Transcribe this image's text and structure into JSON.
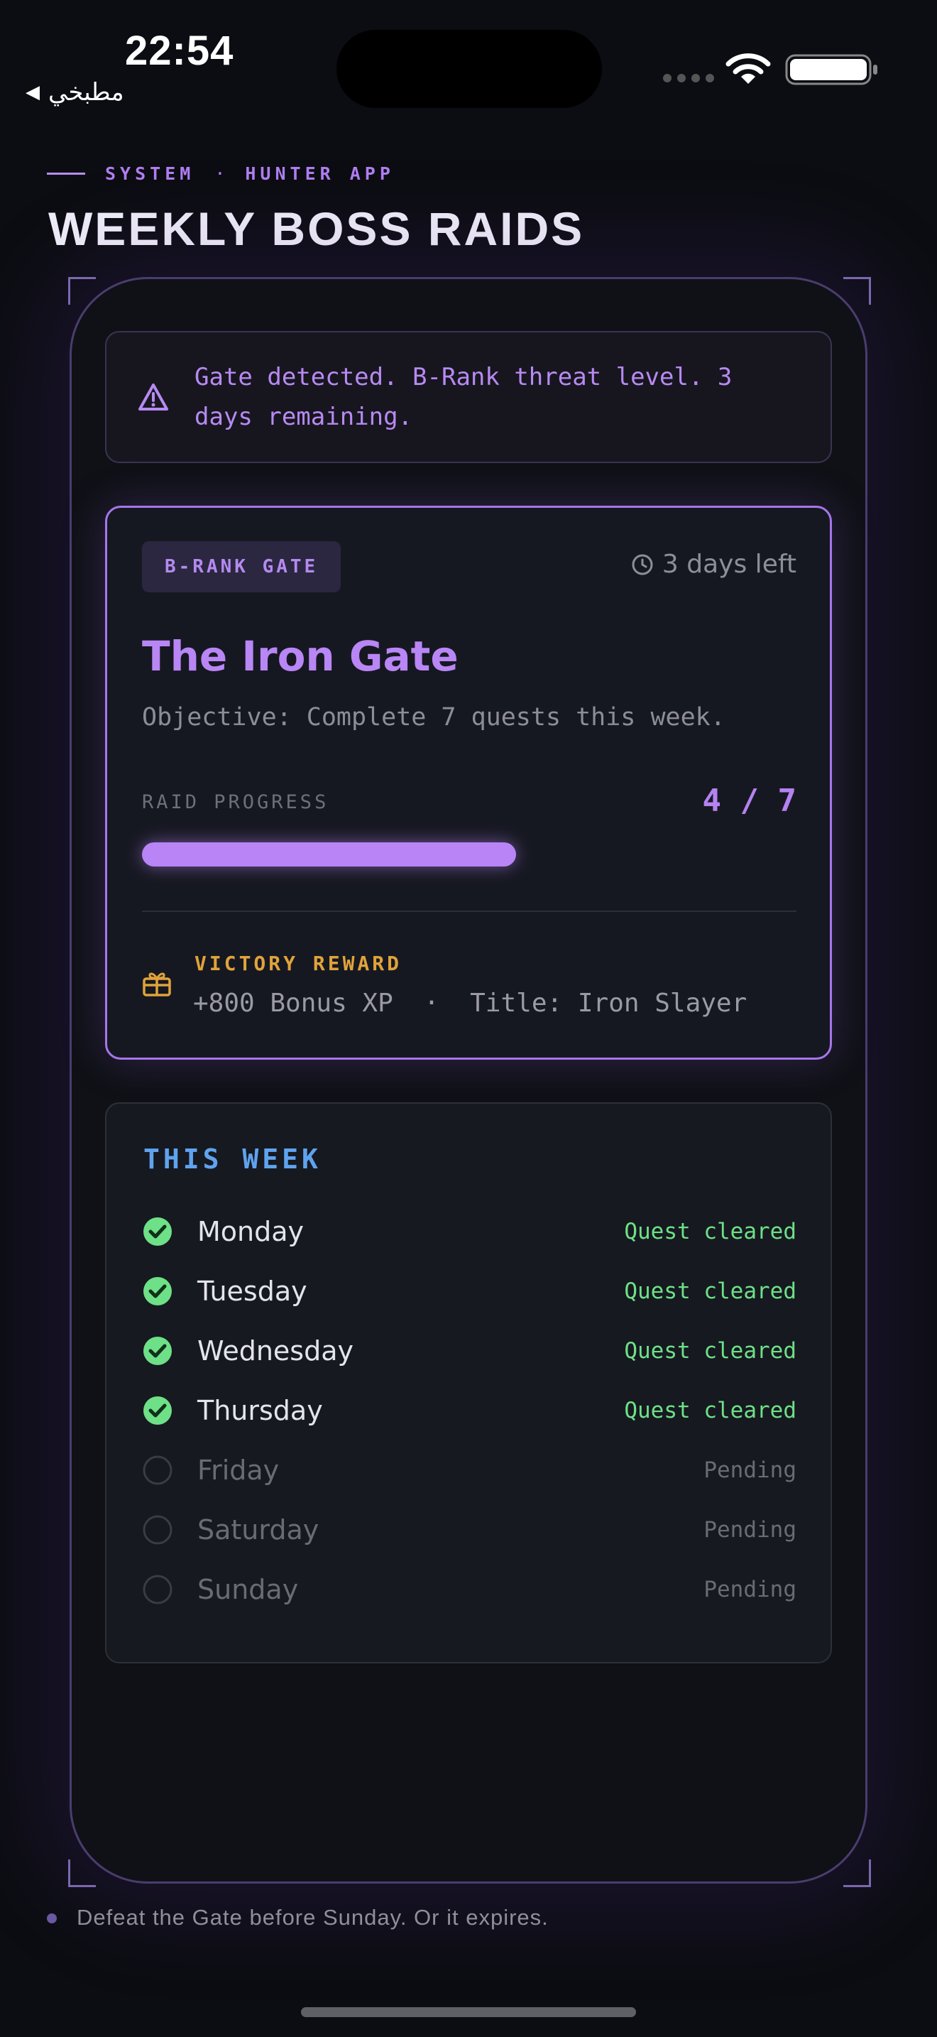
{
  "status_bar": {
    "time": "22:54",
    "back_label": "مطبخي"
  },
  "header": {
    "eyebrow_left": "SYSTEM",
    "eyebrow_sep": "·",
    "eyebrow_right": "HUNTER APP",
    "title": "WEEKLY BOSS RAIDS"
  },
  "alert": {
    "icon": "warning-triangle-icon",
    "message": "Gate detected. B-Rank threat level. 3 days remaining."
  },
  "raid": {
    "badge": "B-RANK GATE",
    "days_left": "3 days left",
    "name": "The Iron Gate",
    "objective": "Objective: Complete 7 quests this week.",
    "progress_label": "RAID PROGRESS",
    "progress_text": "4 / 7",
    "progress_done": 4,
    "progress_total": 7,
    "reward_label": "VICTORY REWARD",
    "reward_text": "+800 Bonus XP  ·  Title: Iron Slayer"
  },
  "week": {
    "title": "THIS WEEK",
    "days": [
      {
        "name": "Monday",
        "status": "Quest cleared",
        "done": true
      },
      {
        "name": "Tuesday",
        "status": "Quest cleared",
        "done": true
      },
      {
        "name": "Wednesday",
        "status": "Quest cleared",
        "done": true
      },
      {
        "name": "Thursday",
        "status": "Quest cleared",
        "done": true
      },
      {
        "name": "Friday",
        "status": "Pending",
        "done": false
      },
      {
        "name": "Saturday",
        "status": "Pending",
        "done": false
      },
      {
        "name": "Sunday",
        "status": "Pending",
        "done": false
      }
    ]
  },
  "footer": {
    "note": "Defeat the Gate before Sunday. Or it expires."
  },
  "colors": {
    "accent_purple": "#b884f6",
    "reward_gold": "#e0a33a",
    "week_blue": "#5fa3ef",
    "cleared_green": "#6ee087"
  }
}
